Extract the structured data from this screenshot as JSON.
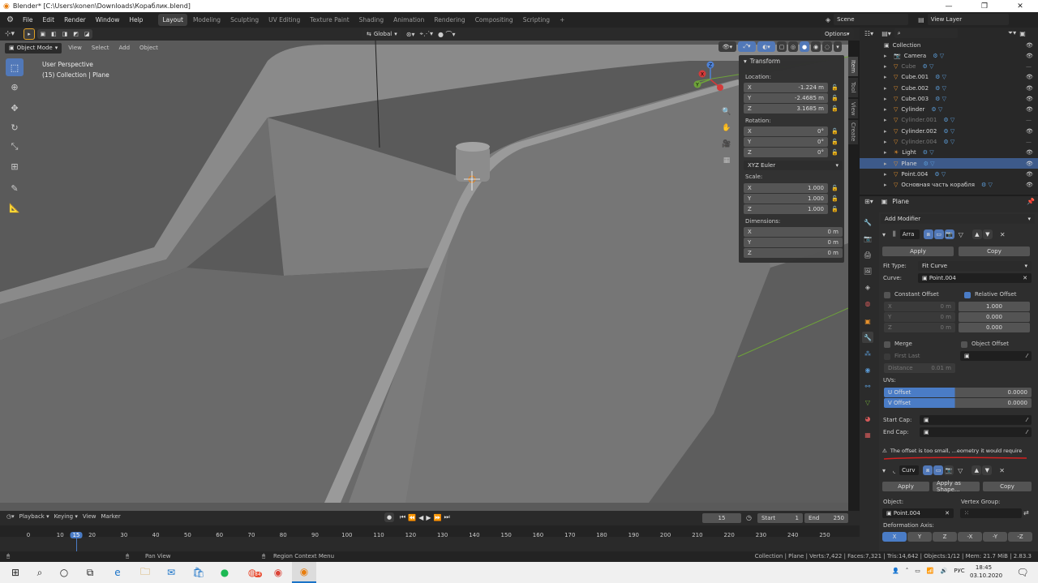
{
  "window": {
    "title": "Blender* [C:\\Users\\konen\\Downloads\\Кораблик.blend]"
  },
  "menu": [
    "File",
    "Edit",
    "Render",
    "Window",
    "Help"
  ],
  "workspaces": [
    {
      "label": "Layout",
      "active": true
    },
    {
      "label": "Modeling",
      "active": false
    },
    {
      "label": "Sculpting",
      "active": false
    },
    {
      "label": "UV Editing",
      "active": false
    },
    {
      "label": "Texture Paint",
      "active": false
    },
    {
      "label": "Shading",
      "active": false
    },
    {
      "label": "Animation",
      "active": false
    },
    {
      "label": "Rendering",
      "active": false
    },
    {
      "label": "Compositing",
      "active": false
    },
    {
      "label": "Scripting",
      "active": false
    }
  ],
  "topright": {
    "scene": "Scene",
    "view_layer": "View Layer"
  },
  "header_tools": {
    "transform_orientation": "Global",
    "options": "Options"
  },
  "viewport_header": {
    "mode": "Object Mode",
    "items": [
      "View",
      "Select",
      "Add",
      "Object"
    ]
  },
  "viewport_overlay": {
    "perspective": "User Perspective",
    "collection": "(15) Collection | Plane"
  },
  "npanel": {
    "title": "Transform",
    "tabs": [
      "Item",
      "Tool",
      "View",
      "Create"
    ],
    "location_label": "Location:",
    "location": [
      {
        "axis": "X",
        "value": "-1.224 m"
      },
      {
        "axis": "Y",
        "value": "-2.4685 m"
      },
      {
        "axis": "Z",
        "value": "3.1685 m"
      }
    ],
    "rotation_label": "Rotation:",
    "rotation": [
      {
        "axis": "X",
        "value": "0°"
      },
      {
        "axis": "Y",
        "value": "0°"
      },
      {
        "axis": "Z",
        "value": "0°"
      }
    ],
    "rotation_mode": "XYZ Euler",
    "scale_label": "Scale:",
    "scale": [
      {
        "axis": "X",
        "value": "1.000"
      },
      {
        "axis": "Y",
        "value": "1.000"
      },
      {
        "axis": "Z",
        "value": "1.000"
      }
    ],
    "dimensions_label": "Dimensions:",
    "dimensions": [
      {
        "axis": "X",
        "value": "0 m"
      },
      {
        "axis": "Y",
        "value": "0 m"
      },
      {
        "axis": "Z",
        "value": "0 m"
      }
    ]
  },
  "outliner": {
    "root": "Collection",
    "items": [
      {
        "name": "Camera",
        "dim": false,
        "selected": false
      },
      {
        "name": "Cube",
        "dim": true,
        "selected": false
      },
      {
        "name": "Cube.001",
        "dim": false,
        "selected": false
      },
      {
        "name": "Cube.002",
        "dim": false,
        "selected": false
      },
      {
        "name": "Cube.003",
        "dim": false,
        "selected": false
      },
      {
        "name": "Cylinder",
        "dim": false,
        "selected": false
      },
      {
        "name": "Cylinder.001",
        "dim": true,
        "selected": false
      },
      {
        "name": "Cylinder.002",
        "dim": false,
        "selected": false
      },
      {
        "name": "Cylinder.004",
        "dim": true,
        "selected": false
      },
      {
        "name": "Light",
        "dim": false,
        "selected": false
      },
      {
        "name": "Plane",
        "dim": false,
        "selected": true
      },
      {
        "name": "Point.004",
        "dim": false,
        "selected": false
      },
      {
        "name": "Основная часть корабля",
        "dim": false,
        "selected": false
      }
    ]
  },
  "properties": {
    "object": "Plane",
    "add_modifier": "Add Modifier",
    "array": {
      "name": "Arra",
      "apply": "Apply",
      "copy": "Copy",
      "fit_type_label": "Fit Type:",
      "fit_type": "Fit Curve",
      "curve_label": "Curve:",
      "curve": "Point.004",
      "constant_offset": "Constant Offset",
      "relative_offset": "Relative Offset",
      "const_xyz": [
        {
          "axis": "X",
          "value": "0 m"
        },
        {
          "axis": "Y",
          "value": "0 m"
        },
        {
          "axis": "Z",
          "value": "0 m"
        }
      ],
      "rel_xyz": [
        "1.000",
        "0.000",
        "0.000"
      ],
      "merge": "Merge",
      "object_offset": "Object Offset",
      "first_last": "First Last",
      "distance_label": "Distance",
      "distance": "0.01 m",
      "uvs": "UVs:",
      "u_offset_label": "U Offset",
      "u_offset": "0.0000",
      "v_offset_label": "V Offset",
      "v_offset": "0.0000",
      "start_cap": "Start Cap:",
      "end_cap": "End Cap:",
      "warning": "The offset is too small, ...eometry it would require"
    },
    "curve_mod": {
      "name": "Curv",
      "apply": "Apply",
      "apply_shape": "Apply as Shape...",
      "copy": "Copy",
      "object_label": "Object:",
      "object": "Point.004",
      "vgroup_label": "Vertex Group:",
      "deform_label": "Deformation Axis:",
      "axes": [
        "X",
        "Y",
        "Z",
        "-X",
        "-Y",
        "-Z"
      ]
    }
  },
  "timeline": {
    "menus": [
      "Playback",
      "Keying",
      "View",
      "Marker"
    ],
    "current_frame": "15",
    "start_label": "Start",
    "start": "1",
    "end_label": "End",
    "end": "250",
    "ticks": [
      "0",
      "10",
      "15",
      "20",
      "30",
      "40",
      "50",
      "60",
      "70",
      "80",
      "90",
      "100",
      "110",
      "120",
      "130",
      "140",
      "150",
      "160",
      "170",
      "180",
      "190",
      "200",
      "210",
      "220",
      "230",
      "240",
      "250"
    ]
  },
  "status": {
    "left1": "Pan View",
    "left2": "Region Context Menu",
    "right": "Collection | Plane | Verts:7,422 | Faces:7,321 | Tris:14,642 | Objects:1/12 | Mem: 21.7 MiB | 2.83.3"
  },
  "taskbar": {
    "time": "18:45",
    "date": "03.10.2020",
    "lang": "РУС",
    "badge": "84"
  },
  "colors": {
    "accent": "#5178b8",
    "selected_row": "#3d5a8a",
    "viewport": "#5d5d5d",
    "warning_underline": "#d42020"
  }
}
